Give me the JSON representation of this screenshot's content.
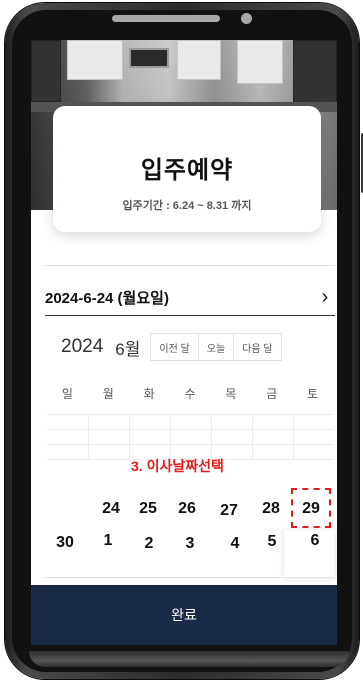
{
  "title_card": {
    "title": "입주예약",
    "period": "입주기간 : 6.24 ~ 8.31 까지"
  },
  "selected_date": {
    "text": "2024-6-24 (월요일)",
    "next_icon": "chevron-right-icon"
  },
  "calendar": {
    "year": "2024",
    "month": "6월",
    "buttons": {
      "prev": "이전 달",
      "today": "오늘",
      "next": "다음 달"
    },
    "weekdays": [
      "일",
      "월",
      "화",
      "수",
      "목",
      "금",
      "토"
    ],
    "week_row_1": [
      "24",
      "25",
      "26",
      "27",
      "28",
      "29"
    ],
    "week_row_2": [
      "30",
      "1",
      "2",
      "3",
      "4",
      "5",
      "6"
    ]
  },
  "annotation": "3. 이사날짜선택",
  "highlight_color": "#e31b1b",
  "confirm": {
    "label": "완료",
    "color": "#192a48"
  }
}
